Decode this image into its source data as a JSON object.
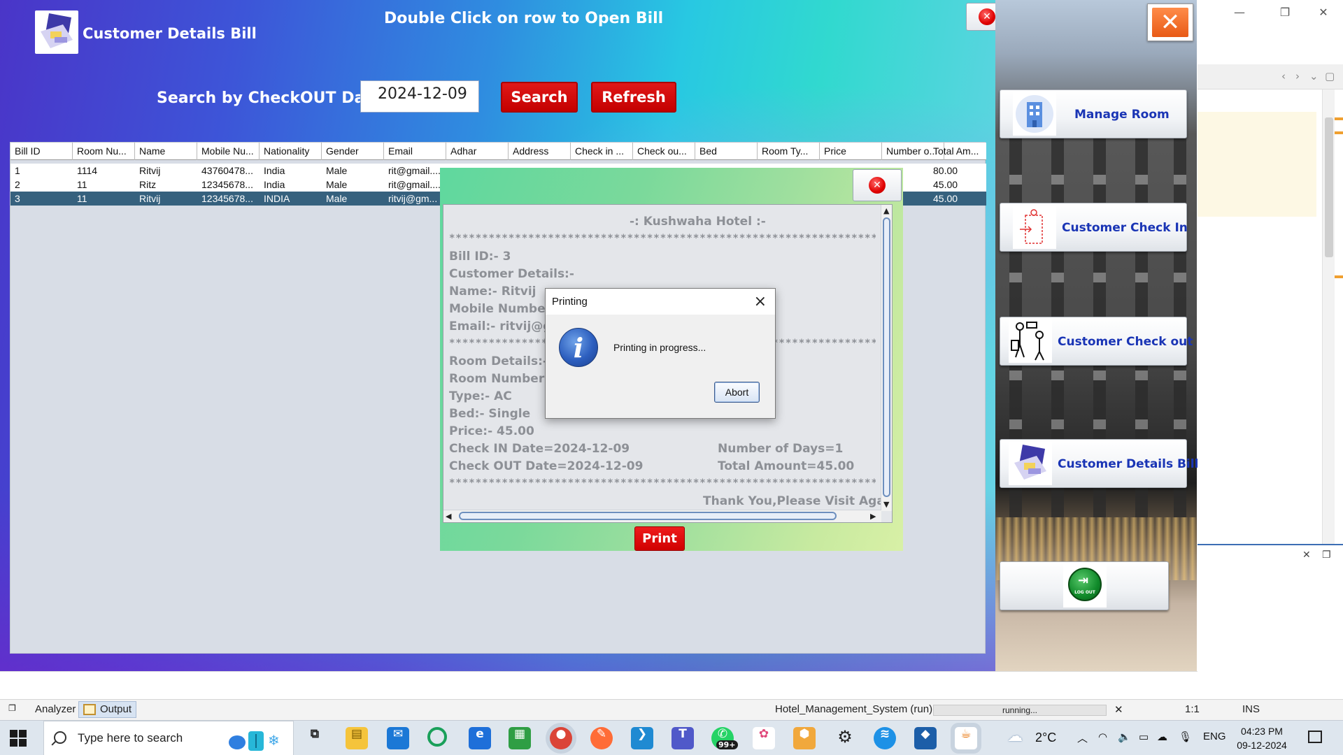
{
  "bill_window": {
    "title": "Customer Details Bill",
    "hint": "Double Click on row to Open Bill",
    "search_label": "Search by CheckOUT Date",
    "date_value": "2024-12-09",
    "search_button": "Search",
    "refresh_button": "Refresh",
    "close_icon": "close-icon",
    "accent_colors": {
      "button_red": "#cc0000",
      "title_text": "#ffffff",
      "selected_row": "#36617e"
    },
    "table": {
      "headers": [
        "Bill ID",
        "Room Nu...",
        "Name",
        "Mobile Nu...",
        "Nationality",
        "Gender",
        "Email",
        "Adhar",
        "Address",
        "Check in ...",
        "Check ou...",
        "Bed",
        "Room Ty...",
        "Price",
        "Number o...",
        "Total Am..."
      ],
      "rows": [
        [
          "1",
          "1114",
          "Ritvij",
          "43760478...",
          "India",
          "Male",
          "rit@gmail....",
          "",
          "",
          "",
          "",
          "",
          "",
          "",
          "",
          "80.00"
        ],
        [
          "2",
          "11",
          "Ritz",
          "12345678...",
          "India",
          "Male",
          "rit@gmail....",
          "",
          "",
          "",
          "",
          "",
          "",
          "",
          "",
          "45.00"
        ],
        [
          "3",
          "11",
          "Ritvij",
          "12345678...",
          "INDIA",
          "Male",
          "ritvij@gm...",
          "",
          "",
          "",
          "",
          "",
          "",
          "",
          "",
          "45.00"
        ]
      ],
      "selected_row": 3
    }
  },
  "bill_popup": {
    "hotel_heading": "-: Kushwaha Hotel :-",
    "stars": "*****************************************************************************",
    "bill_id": "Bill ID:- 3",
    "customer_details": "Customer Details:-",
    "name": "Name:- Ritvij",
    "mobile": "Mobile Number:",
    "email": "Email:- ritvij@gm",
    "room_details": "Room Details:-",
    "room_number": "Room Number:-",
    "type": "Type:- AC",
    "bed": "Bed:- Single",
    "price": "Price:- 45.00",
    "check_in": "Check IN Date=2024-12-09",
    "check_out": "Check OUT Date=2024-12-09",
    "days": "Number of Days=1",
    "total": "Total Amount=45.00",
    "thanks": "Thank You,Please Visit Again.",
    "print_button": "Print",
    "close_icon": "close-icon"
  },
  "print_dialog": {
    "title": "Printing",
    "message": "Printing in progress...",
    "abort_button": "Abort",
    "icon": "info-icon"
  },
  "menu": {
    "items": [
      {
        "label": "Manage Room",
        "icon": "building-icon"
      },
      {
        "label": "Customer Check In",
        "icon": "check-in-icon"
      },
      {
        "label": "Customer Check out",
        "icon": "check-out-icon"
      },
      {
        "label": "Customer Details Bill",
        "icon": "bill-icon"
      }
    ],
    "logout_text": "LOG OUT",
    "close_icon": "close-icon"
  },
  "ide": {
    "analyzer_tab": "Analyzer",
    "output_tab": "Output",
    "run_label": "Hotel_Management_System (run)",
    "progress_text": "running...",
    "position": "1:1",
    "mode": "INS"
  },
  "taskbar": {
    "search_placeholder": "Type here to search",
    "weather": "2°C",
    "language": "ENG",
    "time": "04:23 PM",
    "date": "09-12-2024",
    "badge_whatsapp": "99+",
    "apps": [
      "task-view-icon",
      "file-explorer-icon",
      "mail-icon",
      "app-ring-icon",
      "edge-icon",
      "sheets-icon",
      "chrome-icon",
      "postman-icon",
      "vscode-icon",
      "teams-icon",
      "whatsapp-icon",
      "paint-icon",
      "box-icon",
      "settings-icon",
      "docker-icon",
      "netbeans-icon",
      "java-icon"
    ]
  }
}
